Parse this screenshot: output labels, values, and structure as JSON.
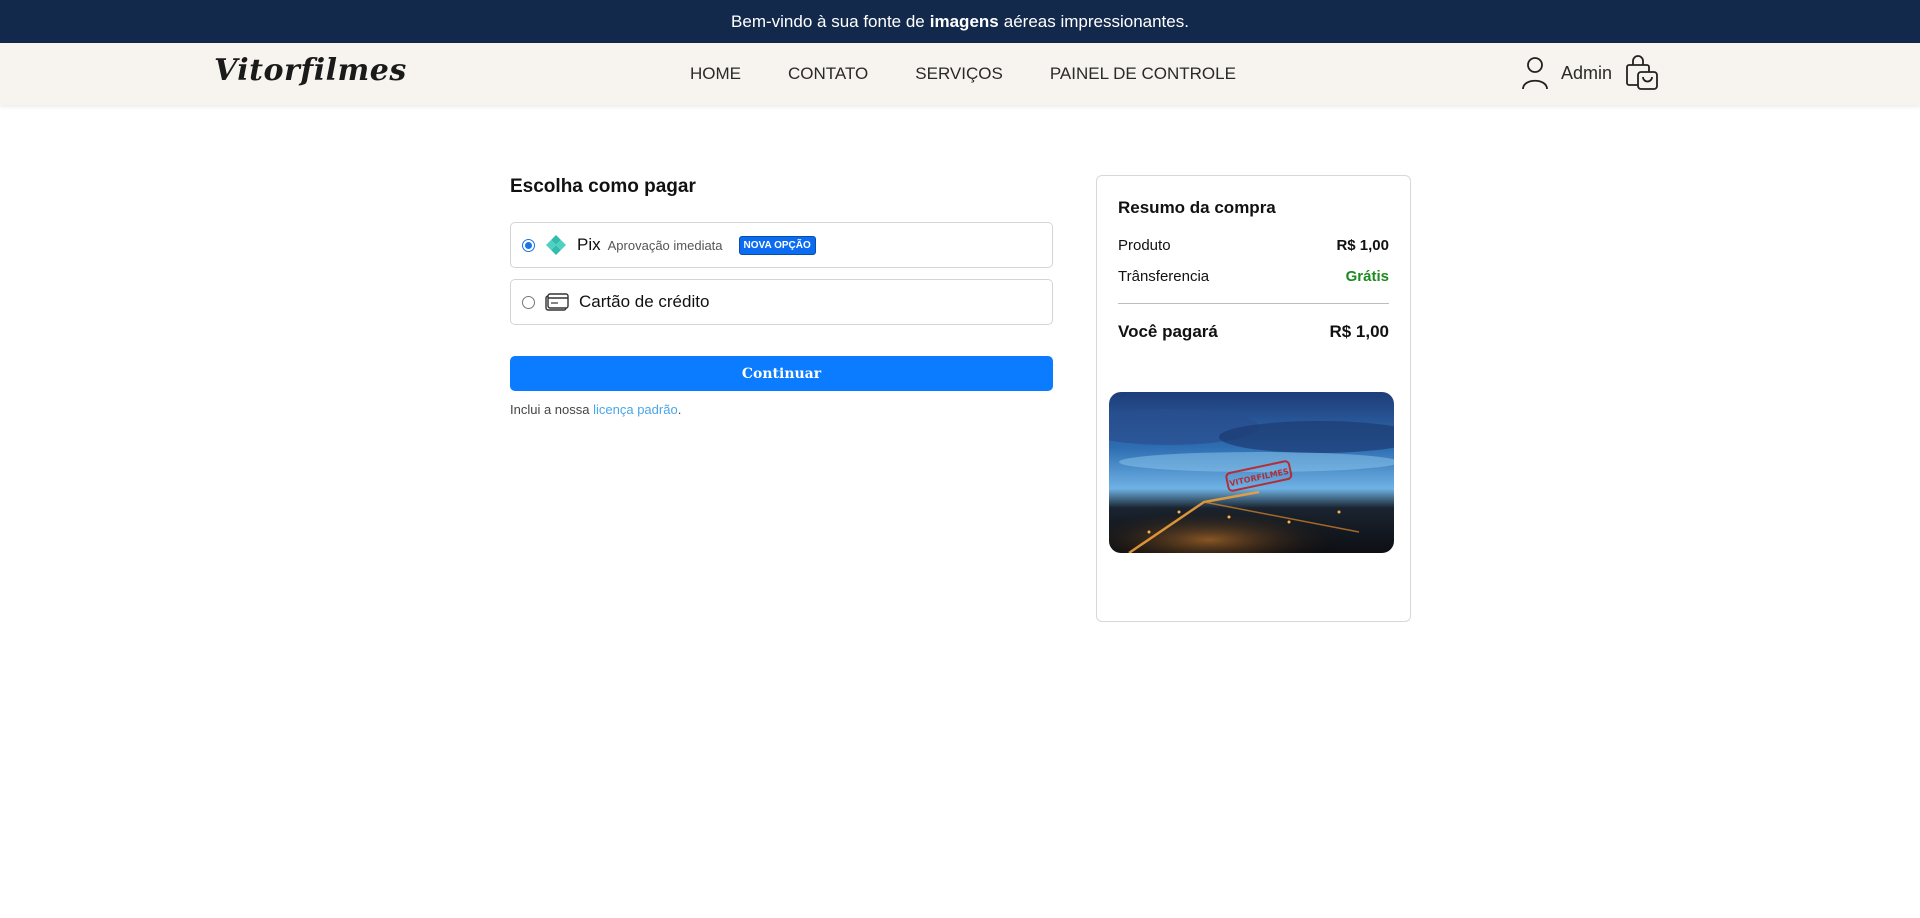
{
  "announcement": {
    "before": "Bem-vindo à sua fonte de",
    "bold": "imagens",
    "after": "aéreas impressionantes."
  },
  "header": {
    "logo": "Vitorfilmes",
    "nav": [
      "HOME",
      "CONTATO",
      "SERVIÇOS",
      "PAINEL DE CONTROLE"
    ],
    "user_label": "Admin"
  },
  "payment": {
    "title": "Escolha como pagar",
    "options": [
      {
        "label": "Pix",
        "sub": "Aprovação imediata",
        "badge": "NOVA OPÇÃO",
        "selected": true,
        "icon": "pix-icon"
      },
      {
        "label": "Cartão de crédito",
        "selected": false,
        "icon": "credit-card-icon"
      }
    ],
    "continue_label": "Continuar",
    "license_prefix": "Inclui a nossa",
    "license_link": "licença padrão",
    "license_suffix": "."
  },
  "summary": {
    "title": "Resumo da compra",
    "product_label": "Produto",
    "product_value": "R$ 1,00",
    "transfer_label": "Trânsferencia",
    "transfer_value": "Grátis",
    "total_label": "Você pagará",
    "total_value": "R$ 1,00",
    "image_stamp": "VITORFILMES"
  },
  "colors": {
    "announce_bg": "#13294b",
    "header_bg": "#f7f3ef",
    "primary": "#0b7bff",
    "badge": "#0b6cf1",
    "free_green": "#1e8a21",
    "link": "#4aa6e8",
    "pix_teal": "#32bcad"
  }
}
